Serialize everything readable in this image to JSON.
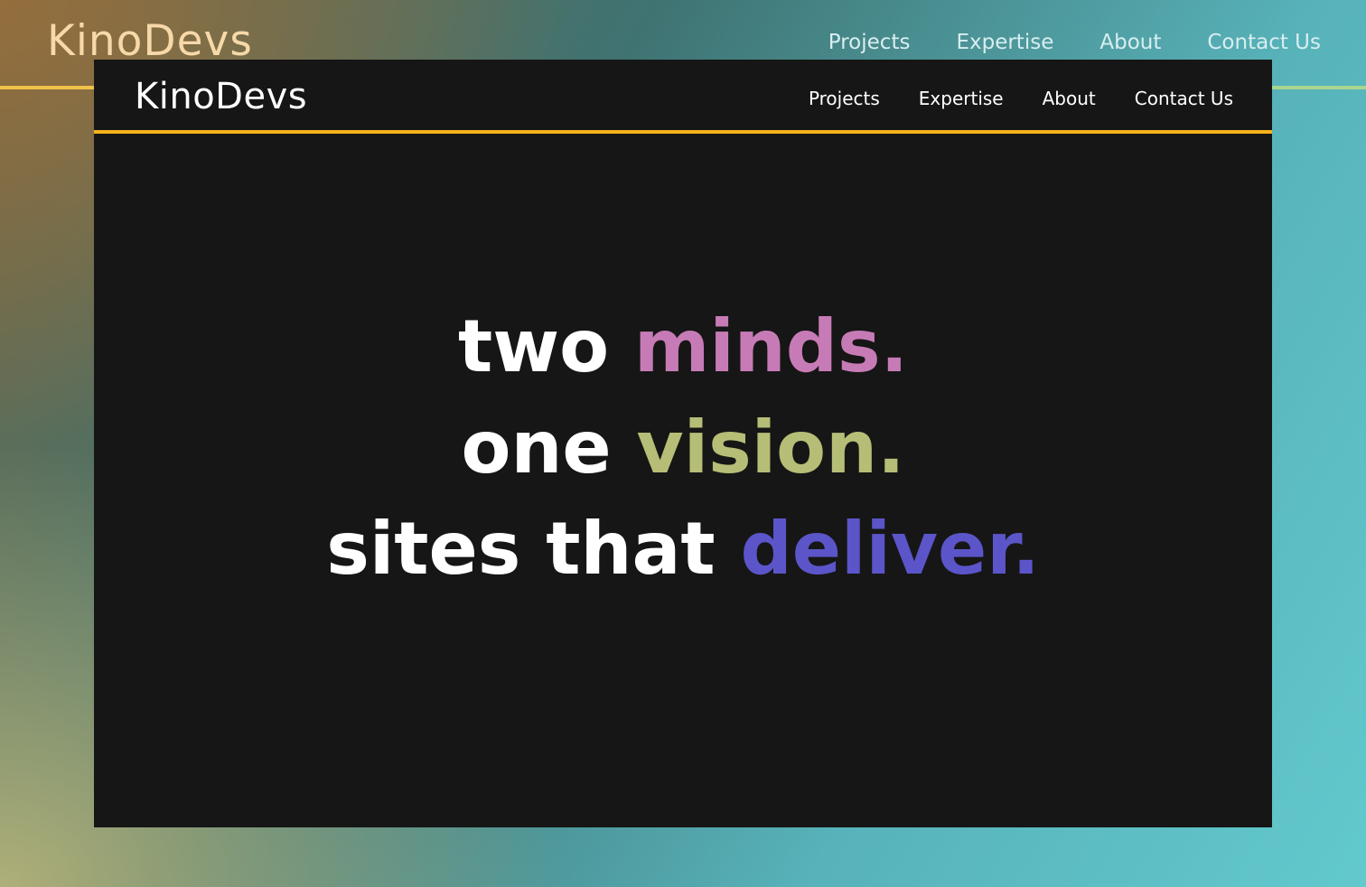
{
  "background": {
    "logo": "KinoDevs",
    "nav": [
      "Projects",
      "Expertise",
      "About",
      "Contact Us"
    ]
  },
  "header": {
    "logo": "KinoDevs",
    "nav": [
      "Projects",
      "Expertise",
      "About",
      "Contact Us"
    ],
    "accent_color": "#f4b41a"
  },
  "hero": {
    "lines": [
      {
        "plain": "two",
        "accent": "minds.",
        "accent_color": "#c77bb6"
      },
      {
        "plain": "one",
        "accent": "vision.",
        "accent_color": "#b6bd76"
      },
      {
        "plain": "sites that",
        "accent": "deliver.",
        "accent_color": "#5b55c9"
      }
    ]
  }
}
